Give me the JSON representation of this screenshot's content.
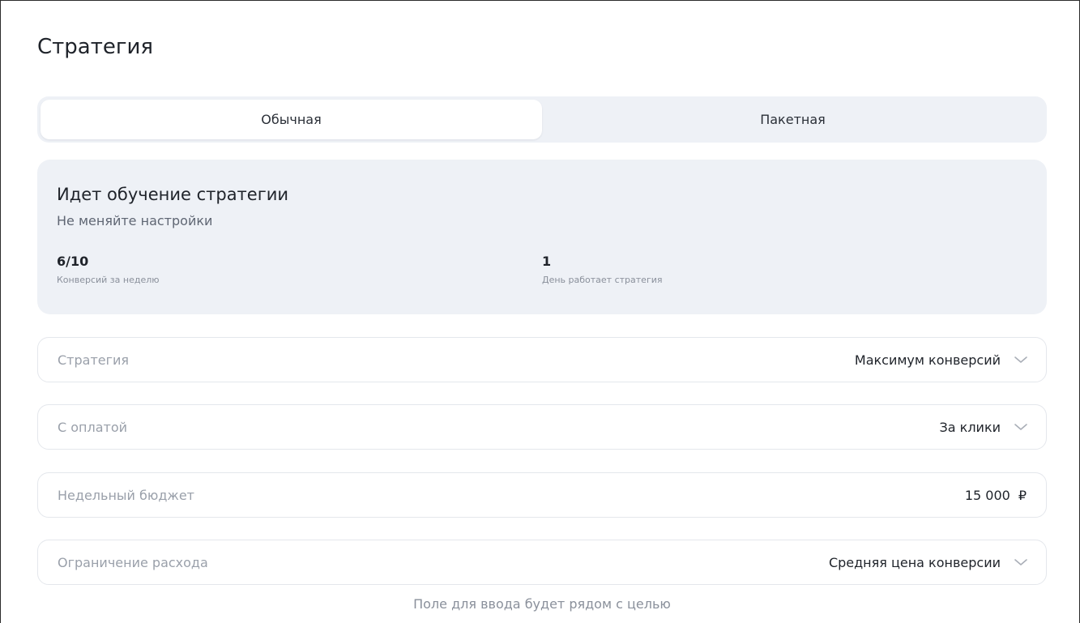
{
  "page": {
    "title": "Стратегия"
  },
  "tabs": [
    {
      "label": "Обычная",
      "active": true
    },
    {
      "label": "Пакетная",
      "active": false
    }
  ],
  "learning": {
    "title": "Идет обучение стратегии",
    "subtitle": "Не меняйте настройки",
    "stats": [
      {
        "value": "6/10",
        "label": "Конверсий за неделю"
      },
      {
        "value": "1",
        "label": "День работает стратегия"
      }
    ]
  },
  "fields": {
    "strategy": {
      "label": "Стратегия",
      "value": "Максимум конверсий",
      "icon": "chevron-down-icon"
    },
    "payment": {
      "label": "С оплатой",
      "value": "За клики",
      "icon": "chevron-down-icon"
    },
    "budget": {
      "label": "Недельный бюджет",
      "value": "15 000",
      "currency": "₽"
    },
    "limit": {
      "label": "Ограничение расхода",
      "value": "Средняя цена конверсии",
      "icon": "chevron-down-icon"
    }
  },
  "hint": "Поле для ввода будет рядом с целью",
  "colors": {
    "panel_bg": "#eef1f6",
    "border": "#e4e7ec",
    "muted_text": "#9aa0aa",
    "text": "#1f232a"
  }
}
